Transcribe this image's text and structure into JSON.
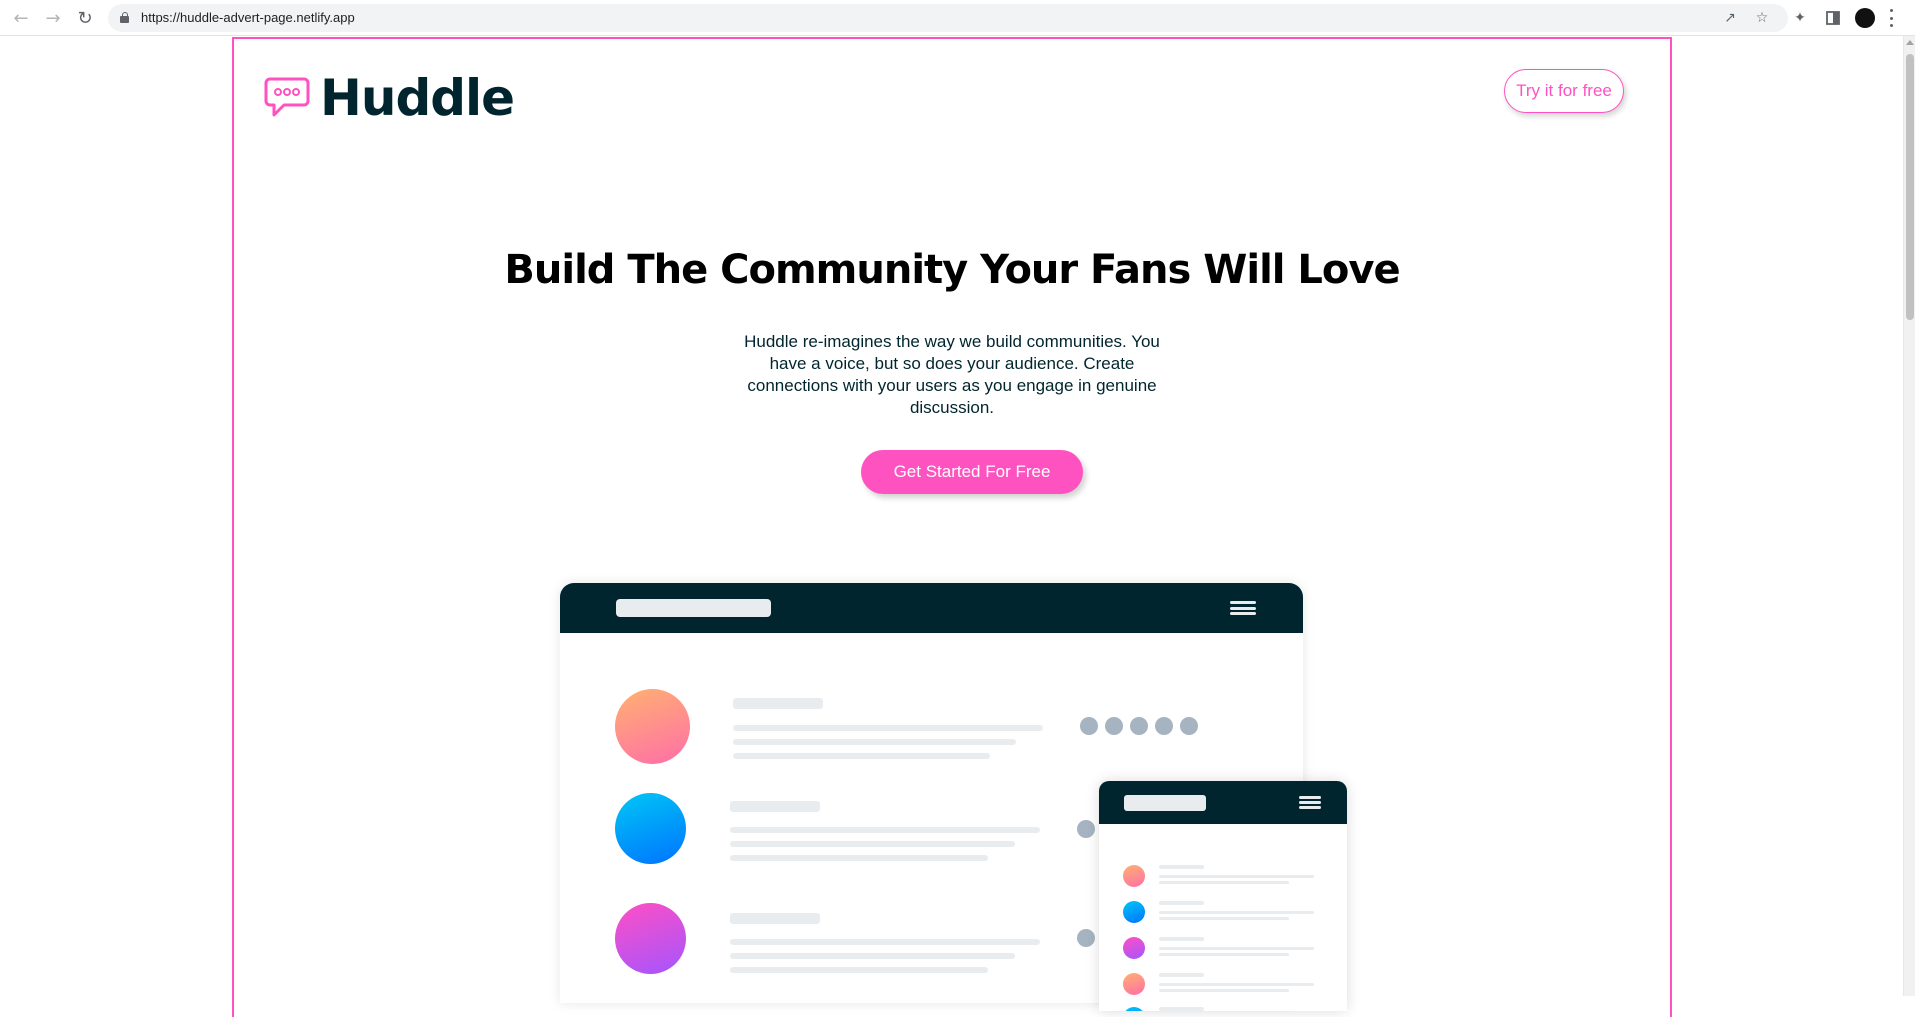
{
  "browser": {
    "url": "https://huddle-advert-page.netlify.app",
    "icons": [
      "back-icon",
      "forward-icon",
      "reload-icon",
      "lock-icon",
      "share-icon",
      "star-icon",
      "extensions-icon",
      "sidepanel-icon",
      "profile-avatar",
      "more-menu-icon"
    ]
  },
  "header": {
    "logo_text": "Huddle",
    "try_button": "Try it for free"
  },
  "hero": {
    "title": "Build The Community Your Fans Will Love",
    "description": "Huddle re-imagines the way we build communities. You have a voice, but so does your audience. Create connections with your users as you engage in genuine discussion.",
    "cta": "Get Started For Free"
  },
  "colors": {
    "accent": "#ff52c1",
    "dark": "#00252e",
    "placeholder": "#e8ecef",
    "dot": "#a6b4c1"
  },
  "illustration": {
    "desktop_avatars": [
      "orange-pink-gradient",
      "blue-gradient",
      "pink-purple-gradient"
    ],
    "mobile_avatars": [
      "orange-pink-gradient",
      "blue-gradient",
      "pink-purple-gradient",
      "orange-pink-gradient",
      "blue-gradient"
    ]
  }
}
